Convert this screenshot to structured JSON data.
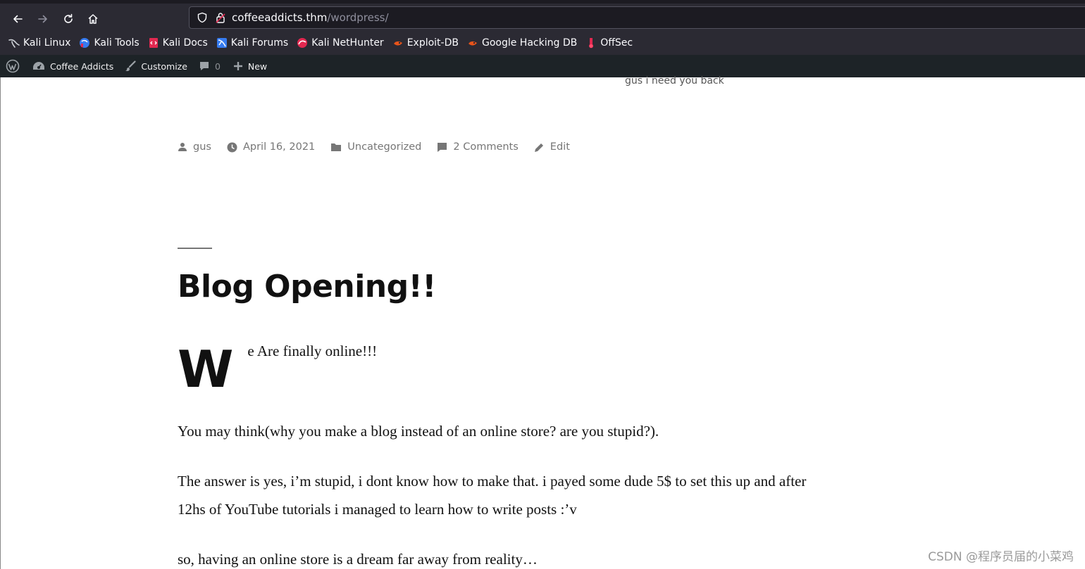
{
  "browser": {
    "url_host": "coffeeaddicts.thm",
    "url_path": "/wordpress/"
  },
  "bookmarks": [
    {
      "label": "Kali Linux",
      "icon": "kali-dragon-icon"
    },
    {
      "label": "Kali Tools",
      "icon": "kali-tools-icon"
    },
    {
      "label": "Kali Docs",
      "icon": "kali-docs-icon"
    },
    {
      "label": "Kali Forums",
      "icon": "kali-forums-icon"
    },
    {
      "label": "Kali NetHunter",
      "icon": "kali-nethunter-icon"
    },
    {
      "label": "Exploit-DB",
      "icon": "exploit-db-icon"
    },
    {
      "label": "Google Hacking DB",
      "icon": "ghdb-icon"
    },
    {
      "label": "OffSec",
      "icon": "offsec-icon"
    }
  ],
  "adminbar": {
    "site_name": "Coffee Addicts",
    "customize": "Customize",
    "comments_count": "0",
    "new": "New"
  },
  "prev_excerpt": "gus i need you back",
  "post_meta": {
    "author": "gus",
    "date": "April 16, 2021",
    "category": "Uncategorized",
    "comments": "2 Comments",
    "edit": "Edit"
  },
  "post": {
    "title": "Blog Opening!!",
    "dropcap": "W",
    "first_line": "e Are finally online!!!",
    "paragraphs": [
      "You may think(why you make a blog instead of an online store? are you stupid?).",
      "The answer is yes, i’m stupid, i dont know how to make that. i payed some dude 5$ to set this up and after 12hs of YouTube tutorials i managed to learn how to write posts :’v",
      "so, having an online store is a dream far away from reality…"
    ]
  },
  "watermark": "CSDN @程序员届的小菜鸡",
  "colors": {
    "browser_bg": "#2b2a33",
    "adminbar_bg": "#1d2327",
    "meta_text": "#767676",
    "exploit_orange": "#e8541a",
    "kali_blue": "#367bf0"
  }
}
